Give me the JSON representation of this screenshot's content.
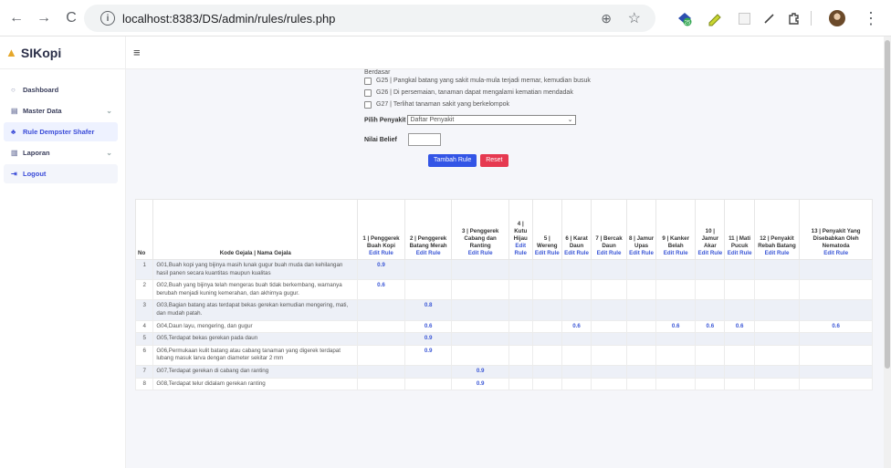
{
  "browser": {
    "url": "localhost:8383/DS/admin/rules/rules.php",
    "back_icon": "←",
    "forward_icon": "→",
    "reload_icon": "C",
    "info_icon": "i",
    "zoom_icon": "⊕",
    "star_icon": "☆",
    "menu_icon": "⋮"
  },
  "sidebar": {
    "brand": "SIKopi",
    "items": [
      {
        "label": "Dashboard",
        "icon": "○",
        "chevron": ""
      },
      {
        "label": "Master Data",
        "icon": "▤",
        "chevron": "⌄"
      },
      {
        "label": "Rule Dempster Shafer",
        "icon": "♣",
        "chevron": ""
      },
      {
        "label": "Laporan",
        "icon": "▥",
        "chevron": "⌄"
      },
      {
        "label": "Logout",
        "icon": "⇥",
        "chevron": ""
      }
    ]
  },
  "topbar": {
    "menu_icon": "≡"
  },
  "form": {
    "partial_line": "Berdasar",
    "checkboxes": [
      "G25 | Pangkal batang yang sakit mula-mula terjadi memar, kemudian busuk",
      "G26 | Di persemaian, tanaman dapat mengalami kematian mendadak",
      "G27 | Terlihat tanaman sakit yang berkelompok"
    ],
    "select_label": "Pilih Penyakit",
    "select_value": "Daftar Penyakit",
    "belief_label": "Nilai Belief",
    "add_button": "Tambah Rule",
    "reset_button": "Reset"
  },
  "table": {
    "col_no": "No",
    "col_gejala": "Kode Gejala | Nama Gejala",
    "edit_label": "Edit Rule",
    "diseases": [
      "1 | Penggerek Buah Kopi",
      "2 | Penggerek Batang Merah",
      "3 | Penggerek Cabang dan Ranting",
      "4 | Kutu Hijau",
      "5 | Wereng",
      "6 | Karat Daun",
      "7 | Bercak Daun",
      "8 | Jamur Upas",
      "9 | Kanker Belah",
      "10 | Jamur Akar",
      "11 | Mati Pucuk",
      "12 | Penyakit Rebah Batang",
      "13 | Penyakit Yang Disebabkan Oleh Nematoda"
    ],
    "rows": [
      {
        "no": "1",
        "gejala": "G01,Buah kopi yang bijinya masih lunak gugur buah muda dan kehilangan hasil panen secara kuantitas maupun kualitas",
        "values": [
          "0.9",
          "",
          "",
          "",
          "",
          "",
          "",
          "",
          "",
          "",
          "",
          "",
          ""
        ]
      },
      {
        "no": "2",
        "gejala": "G02,Buah yang bijinya telah mengeras buah tidak berkembang, warnanya berubah menjadi kuning kemerahan, dan akhirnya gugur.",
        "values": [
          "0.6",
          "",
          "",
          "",
          "",
          "",
          "",
          "",
          "",
          "",
          "",
          "",
          ""
        ]
      },
      {
        "no": "3",
        "gejala": "G03,Bagian batang atas terdapat bekas gerekan kemudian mengering, mati, dan mudah patah.",
        "values": [
          "",
          "0.8",
          "",
          "",
          "",
          "",
          "",
          "",
          "",
          "",
          "",
          "",
          ""
        ]
      },
      {
        "no": "4",
        "gejala": "G04,Daun layu, mengering, dan gugur",
        "values": [
          "",
          "0.6",
          "",
          "",
          "",
          "0.6",
          "",
          "",
          "0.6",
          "0.6",
          "0.6",
          "",
          "0.6"
        ]
      },
      {
        "no": "5",
        "gejala": "G05,Terdapat bekas gerekan pada daun",
        "values": [
          "",
          "0.9",
          "",
          "",
          "",
          "",
          "",
          "",
          "",
          "",
          "",
          "",
          ""
        ]
      },
      {
        "no": "6",
        "gejala": "G06,Permukaan kulit batang atau cabang tanaman yang digerek terdapat lubang masuk larva dengan diameter sekitar 2 mm",
        "values": [
          "",
          "0.9",
          "",
          "",
          "",
          "",
          "",
          "",
          "",
          "",
          "",
          "",
          ""
        ]
      },
      {
        "no": "7",
        "gejala": "G07,Terdapat gerekan di cabang dan ranting",
        "values": [
          "",
          "",
          "0.9",
          "",
          "",
          "",
          "",
          "",
          "",
          "",
          "",
          "",
          ""
        ]
      },
      {
        "no": "8",
        "gejala": "G08,Terdapat telur didalam gerekan ranting",
        "values": [
          "",
          "",
          "0.9",
          "",
          "",
          "",
          "",
          "",
          "",
          "",
          "",
          "",
          ""
        ]
      }
    ]
  }
}
